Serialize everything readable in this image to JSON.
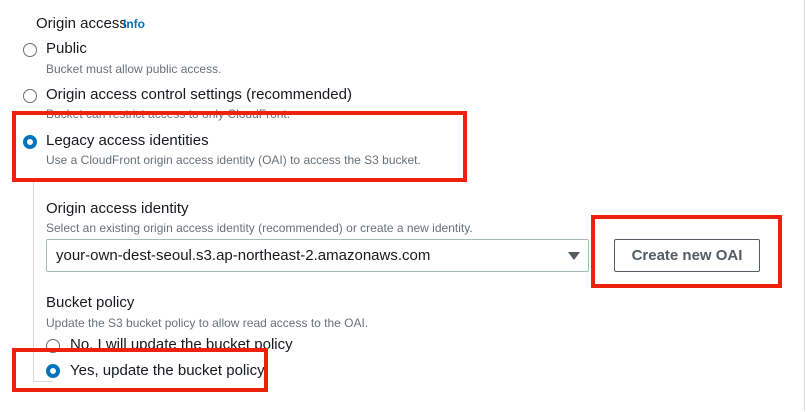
{
  "origin_access": {
    "title": "Origin access",
    "info_link": "Info",
    "options": [
      {
        "label": "Public",
        "description": "Bucket must allow public access.",
        "selected": false
      },
      {
        "label": "Origin access control settings (recommended)",
        "description": "Bucket can restrict access to only CloudFront.",
        "selected": false
      },
      {
        "label": "Legacy access identities",
        "description": "Use a CloudFront origin access identity (OAI) to access the S3 bucket.",
        "selected": true
      }
    ]
  },
  "oai": {
    "label": "Origin access identity",
    "description": "Select an existing origin access identity (recommended) or create a new identity.",
    "selected_value": "your-own-dest-seoul.s3.ap-northeast-2.amazonaws.com",
    "create_button": "Create new OAI"
  },
  "bucket_policy": {
    "label": "Bucket policy",
    "description": "Update the S3 bucket policy to allow read access to the OAI.",
    "options": [
      {
        "label": "No, I will update the bucket policy",
        "selected": false
      },
      {
        "label": "Yes, update the bucket policy",
        "selected": true
      }
    ]
  },
  "colors": {
    "accent": "#0073bb",
    "highlight": "#f0210c",
    "muted_text": "#687078"
  }
}
